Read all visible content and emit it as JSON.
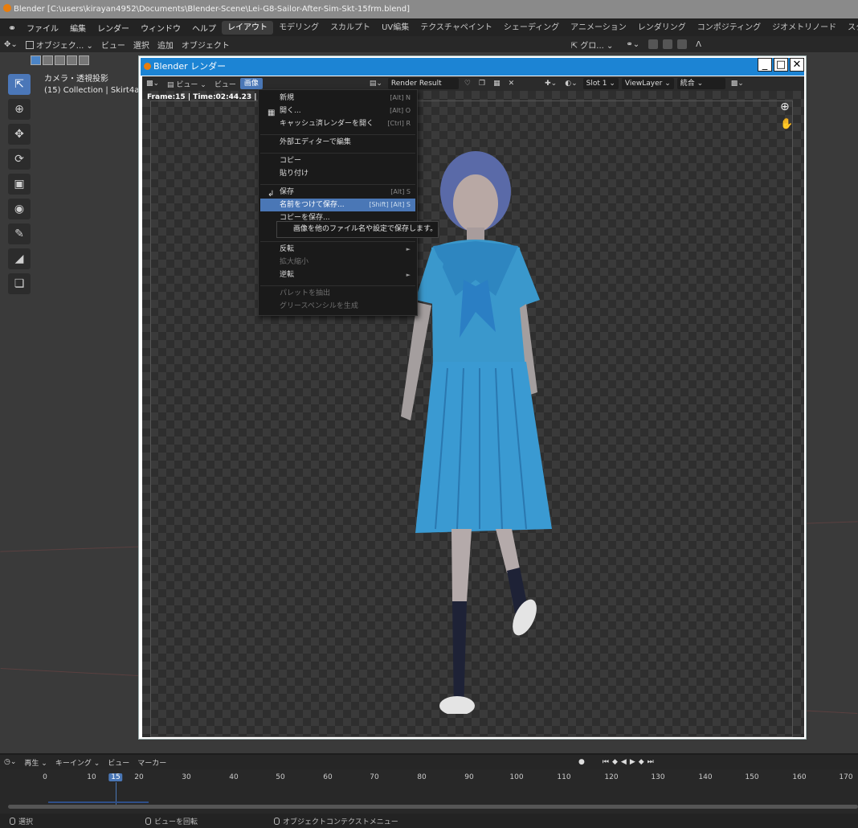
{
  "window_title": "Blender [C:\\users\\kirayan4952\\Documents\\Blender-Scene\\Lei-G8-Sailor-After-Sim-Skt-15frm.blend]",
  "topbar": {
    "menus": [
      "ファイル",
      "編集",
      "レンダー",
      "ウィンドウ",
      "ヘルプ"
    ],
    "workspaces": [
      "レイアウト",
      "モデリング",
      "スカルプト",
      "UV編集",
      "テクスチャペイント",
      "シェーディング",
      "アニメーション",
      "レンダリング",
      "コンポジティング",
      "ジオメトリノード",
      "スクリプト作成",
      "+"
    ],
    "active_workspace": "レイアウト"
  },
  "viewport_header": {
    "mode": "オブジェク...",
    "menus": [
      "ビュー",
      "選択",
      "追加",
      "オブジェクト"
    ],
    "transform_orientation": "グロ..."
  },
  "viewport": {
    "camera_label": "カメラ・透視投影",
    "collection_label": "(15) Collection | Skirt4a",
    "tools": [
      "select-box",
      "cursor",
      "move",
      "rotate",
      "scale",
      "transform",
      "annotate",
      "measure",
      "add-cube"
    ]
  },
  "render_window": {
    "title": "Blender レンダー",
    "header": {
      "menus": [
        "ビュー",
        "ビュー",
        "画像"
      ],
      "active_menu": "画像",
      "image_name": "Render Result",
      "slot": "Slot 1",
      "view_layer": "ViewLayer",
      "pass": "統合"
    },
    "frame_info": "Frame:15 | Time:02:44.23 | Mem:"
  },
  "image_menu": {
    "items": [
      {
        "label": "新規",
        "shortcut": "[Alt] N"
      },
      {
        "label": "開く...",
        "shortcut": "[Alt] O"
      },
      {
        "label": "キャッシュ済レンダーを開く",
        "shortcut": "[Ctrl] R"
      },
      {
        "label": "外部エディターで編集",
        "shortcut": ""
      },
      {
        "label": "コピー",
        "shortcut": ""
      },
      {
        "label": "貼り付け",
        "shortcut": ""
      },
      {
        "label": "保存",
        "shortcut": "[Alt] S"
      },
      {
        "label": "名前をつけて保存...",
        "shortcut": "[Shift] [Alt] S"
      },
      {
        "label": "コピーを保存...",
        "shortcut": ""
      },
      {
        "label": "反転",
        "shortcut": ""
      },
      {
        "label": "拡大縮小",
        "shortcut": ""
      },
      {
        "label": "逆転",
        "shortcut": ""
      },
      {
        "label": "パレットを抽出",
        "shortcut": ""
      },
      {
        "label": "グリースペンシルを生成",
        "shortcut": ""
      }
    ],
    "tooltip": "画像を他のファイル名や設定で保存します。"
  },
  "timeline": {
    "menus": [
      "再生",
      "キーイング",
      "ビュー",
      "マーカー"
    ],
    "frames": [
      "0",
      "10",
      "15",
      "20",
      "30",
      "40",
      "50",
      "60",
      "70",
      "80",
      "90",
      "100",
      "110",
      "120",
      "130",
      "140",
      "150",
      "160",
      "170"
    ],
    "current_frame": "15"
  },
  "statusbar": {
    "left": "選択",
    "middle": "ビューを回転",
    "right": "オブジェクトコンテクストメニュー"
  },
  "colors": {
    "accent": "#4a77b6",
    "render_title": "#1c84d4",
    "blender_orange": "#e87d0d"
  }
}
